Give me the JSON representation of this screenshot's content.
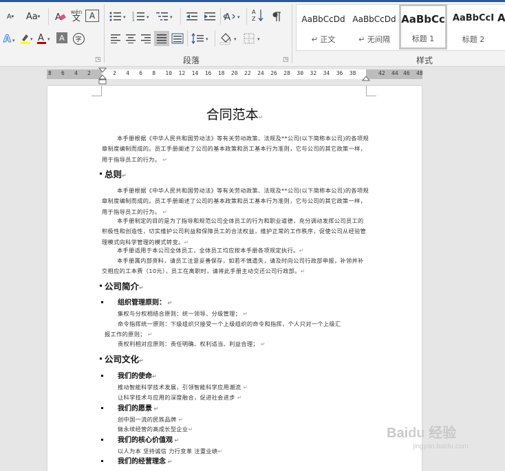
{
  "ribbon": {
    "font_group": {
      "change_case": "Aa",
      "phonetic_top": "wén",
      "phonetic_bottom": "文",
      "char_border": "A",
      "char_shading": "A",
      "enclose_char": "字",
      "clear_format": "A",
      "grow_font": "A",
      "highlight_color": "#ffff00",
      "font_color": "#c00000"
    },
    "paragraph_group": {
      "label": "段落"
    },
    "styles_group": {
      "label": "样式",
      "tiles": [
        {
          "preview": "AaBbCcDd",
          "name": "↵ 正文"
        },
        {
          "preview": "AaBbCcDd",
          "name": "↵ 无间隔"
        },
        {
          "preview": "AaBbCc",
          "name": "标题 1"
        },
        {
          "preview": "AaBbCcI",
          "name": "标题 2"
        },
        {
          "preview": "A",
          "name": ""
        }
      ]
    }
  },
  "ruler": {
    "left_ticks": [
      "8",
      "6",
      "4",
      "2"
    ],
    "right_ticks": [
      "2",
      "4",
      "6",
      "8",
      "10",
      "12",
      "14",
      "16",
      "18",
      "20",
      "22",
      "24",
      "26",
      "28",
      "30",
      "32",
      "34",
      "36",
      "38"
    ],
    "margin_ticks": [
      "42",
      "44",
      "46",
      "48"
    ]
  },
  "document": {
    "title": "合同范本",
    "para_mark": "↵",
    "intro": "本手册根据《中华人民共和国劳动法》等有关劳动政策、法规及**公司(以下简称本公司)的各项规章制度编制而成的。员工手册阐述了公司的基本政策和员工基本行为准则，它与公司的其它政策一样，用于指导员工的行为。",
    "sections": {
      "general": "总则",
      "profile": "公司简介",
      "culture": "公司文化"
    },
    "general_paras": [
      "本手册根据《中华人民共和国劳动法》等有关劳动政策、法规及**公司(以下简称本公司)的各项规章制度编制而成的。员工手册阐述了公司的基本政策和员工基本行为准则，它与公司的其它政策一样，用于指导员工的行为。",
      "本手册制定的目的是为了指导和规范公司全体员工的行为和职业道德，充分调动发挥公司员工的积极性和创造性，切实维护公司利益和保障员工的合法权益，维护正常的工作秩序，促使公司从经验管理模式向科学管理的模式转变。",
      "本手册适用于本公司全体员工，全体员工均应按本手册各项规定执行。",
      "本手册属内部资料，请员工注意妥善保存，如若不慎遗失，请及时向公司行政部申报，补领并补交相应的工本费（10元），员工在离职时，请将此手册主动交还公司行政部。"
    ],
    "org": {
      "heading": "组织管理原则：",
      "lines": [
        "集权与分权相结合原则：统一领导、分级管理；",
        "命令指挥统一原则：下级组织只接受一个上级组织的命令和指挥，个人只对一个上级汇",
        "报工作的原则；",
        "责权利相对应原则：责任明确、权利适当、利益合理；"
      ]
    },
    "mission": {
      "heading": "我们的使命",
      "lines": [
        "推动智能科学技术发展，引领智能科学应用潮流",
        "让科学技术与应用的深度融合，促进社会进步"
      ]
    },
    "vision": {
      "heading": "我们的愿景",
      "lines": [
        "创中国一流的民族品牌",
        "做永续经营的高成长型企业"
      ]
    },
    "values": {
      "heading": "我们的核心价值观",
      "lines": [
        "以人为本   坚持诚信   力行变革   注重业绩"
      ]
    },
    "philosophy": {
      "heading": "我们的经营理念"
    }
  },
  "watermark": {
    "brand": "Bai",
    "brand2": "经验",
    "url": "jingyan.baidu.com"
  }
}
